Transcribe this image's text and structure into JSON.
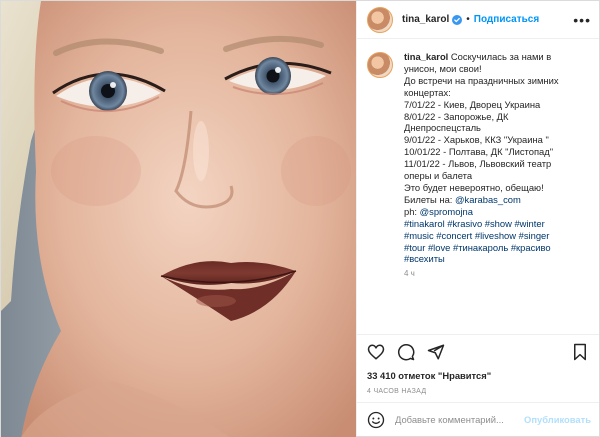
{
  "post": {
    "username": "tina_karol",
    "verified": true,
    "separator": "•",
    "follow_label": "Подписаться",
    "more_icon": "more-icon",
    "colors": {
      "accent": "#0095f6",
      "publish_disabled": "#b2dffc",
      "secondary_text": "#8e8e8e",
      "hashtag": "#00376b"
    }
  },
  "caption": {
    "username": "tina_karol",
    "lines": [
      "Соскучилась за нами в",
      "унисон, мои свои!",
      "До встречи на праздничных зимних",
      "концертах:",
      "7/01/22 - Киев, Дворец Украина",
      "8/01/22 - Запорожье, ДК",
      "Днепроспецсталь",
      "9/01/22 - Харьков, ККЗ \"Украина \"",
      "10/01/22 - Полтава, ДК \"Листопад\"",
      "11/01/22 - Львов, Львовский театр",
      "оперы и балета",
      "Это будет невероятно, обещаю!"
    ],
    "tickets_label": "Билеты на: ",
    "tickets_link": "@karabas_com",
    "photo_label": "ph: ",
    "photo_link": "@spromojna",
    "hashtag_lines": [
      "#tinakarol #krasivo #show #winter",
      "#music #concert #liveshow #singer",
      "#tour #love #тинакароль #красиво",
      "#всехиты"
    ],
    "overflow_text": "4 ч"
  },
  "actions": {
    "icons": [
      "heart-icon",
      "comment-icon",
      "share-icon",
      "bookmark-icon"
    ]
  },
  "likes_text": "33 410 отметок \"Нравится\"",
  "timestamp": "4 ЧАСОВ НАЗАД",
  "comment": {
    "placeholder": "Добавьте комментарий...",
    "publish_label": "Опубликовать"
  }
}
